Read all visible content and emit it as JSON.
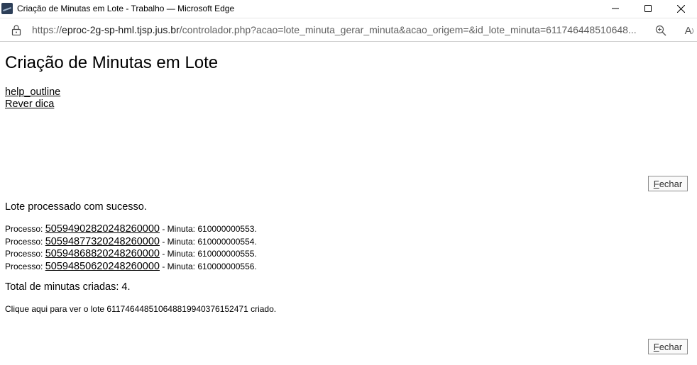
{
  "window": {
    "title": "Criação de Minutas em Lote - Trabalho — Microsoft Edge",
    "minimize": "—",
    "maximize": "☐",
    "close": "✕"
  },
  "address_bar": {
    "scheme": "https://",
    "host": "eproc-2g-sp-hml.tjsp.jus.br",
    "path": "/controlador.php?acao=lote_minuta_gerar_minuta&acao_origem=&id_lote_minuta=611746448510648...",
    "icons": [
      "lock-icon",
      "zoom-icon",
      "read-aloud-icon"
    ],
    "read_aloud_label": "A"
  },
  "page": {
    "title": "Criação de Minutas em Lote",
    "help_link": "help_outline",
    "rever_link": "Rever dica",
    "fechar_accesskey": "F",
    "fechar_rest": "echar",
    "message": "Lote processado com sucesso.",
    "processes": [
      {
        "prefix": "Processo: ",
        "numero": "50594902820248260000",
        "suffix": " - Minuta: 610000000553."
      },
      {
        "prefix": "Processo: ",
        "numero": "50594877320248260000",
        "suffix": " - Minuta: 610000000554."
      },
      {
        "prefix": "Processo: ",
        "numero": "50594868820248260000",
        "suffix": " - Minuta: 610000000555."
      },
      {
        "prefix": "Processo: ",
        "numero": "50594850620248260000",
        "suffix": " - Minuta: 610000000556."
      }
    ],
    "total": "Total de minutas criadas: 4.",
    "clique": "Clique aqui para ver o lote 611746448510648819940376152471 criado."
  }
}
